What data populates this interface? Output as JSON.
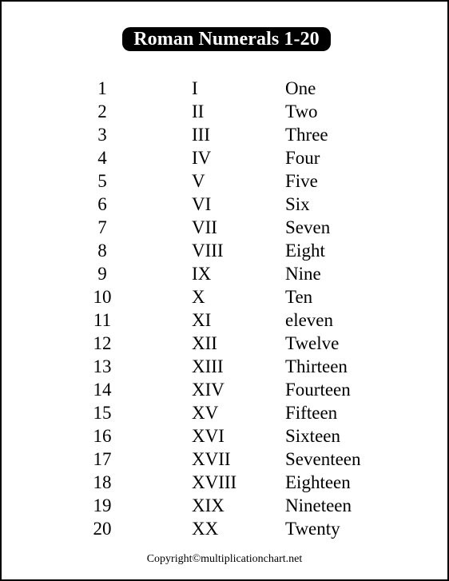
{
  "title": {
    "text": "Roman Numerals 1-20",
    "background_color": "#000000",
    "text_color": "#ffffff"
  },
  "table": {
    "columns": [
      "number",
      "roman",
      "word"
    ],
    "rows": [
      {
        "number": "1",
        "roman": "I",
        "word": "One"
      },
      {
        "number": "2",
        "roman": "II",
        "word": "Two"
      },
      {
        "number": "3",
        "roman": "III",
        "word": "Three"
      },
      {
        "number": "4",
        "roman": "IV",
        "word": "Four"
      },
      {
        "number": "5",
        "roman": "V",
        "word": "Five"
      },
      {
        "number": "6",
        "roman": "VI",
        "word": "Six"
      },
      {
        "number": "7",
        "roman": "VII",
        "word": "Seven"
      },
      {
        "number": "8",
        "roman": "VIII",
        "word": "Eight"
      },
      {
        "number": "9",
        "roman": "IX",
        "word": "Nine"
      },
      {
        "number": "10",
        "roman": "X",
        "word": "Ten"
      },
      {
        "number": "11",
        "roman": "XI",
        "word": "eleven"
      },
      {
        "number": "12",
        "roman": "XII",
        "word": "Twelve"
      },
      {
        "number": "13",
        "roman": "XIII",
        "word": "Thirteen"
      },
      {
        "number": "14",
        "roman": "XIV",
        "word": "Fourteen"
      },
      {
        "number": "15",
        "roman": "XV",
        "word": "Fifteen"
      },
      {
        "number": "16",
        "roman": "XVI",
        "word": "Sixteen"
      },
      {
        "number": "17",
        "roman": "XVII",
        "word": "Seventeen"
      },
      {
        "number": "18",
        "roman": "XVIII",
        "word": "Eighteen"
      },
      {
        "number": "19",
        "roman": "XIX",
        "word": "Nineteen"
      },
      {
        "number": "20",
        "roman": "XX",
        "word": "Twenty"
      }
    ]
  },
  "footer": {
    "text": "Copyright©multiplicationchart.net"
  },
  "page": {
    "border_color": "#000000",
    "background_color": "#ffffff",
    "text_color": "#000000"
  }
}
